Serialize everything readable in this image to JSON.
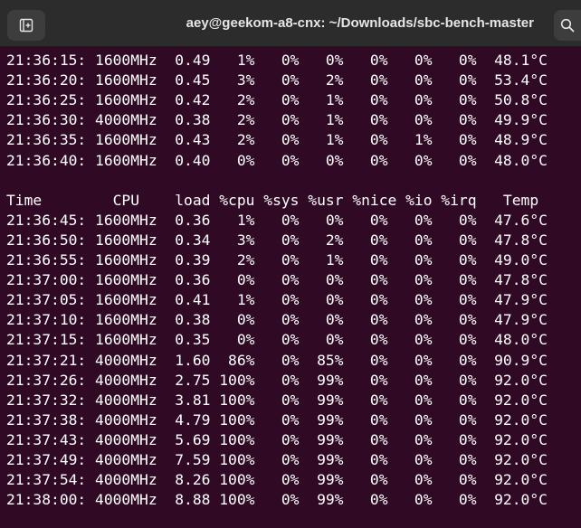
{
  "window": {
    "title": "aey@geekom-a8-cnx: ~/Downloads/sbc-bench-master"
  },
  "icons": {
    "new_tab": "new-tab-icon",
    "search": "search-icon"
  },
  "colors": {
    "terminal_bg": "#300a24",
    "titlebar_bg": "#2c2c2c",
    "text": "#ffffff"
  },
  "terminal": {
    "lines": [
      "21:36:15: 1600MHz  0.49   1%   0%   0%   0%   0%   0%  48.1°C",
      "21:36:20: 1600MHz  0.45   3%   0%   2%   0%   0%   0%  53.4°C",
      "21:36:25: 1600MHz  0.42   2%   0%   1%   0%   0%   0%  50.8°C",
      "21:36:30: 4000MHz  0.38   2%   0%   1%   0%   0%   0%  49.9°C",
      "21:36:35: 1600MHz  0.43   2%   0%   1%   0%   1%   0%  48.9°C",
      "21:36:40: 1600MHz  0.40   0%   0%   0%   0%   0%   0%  48.0°C",
      "",
      "Time        CPU    load %cpu %sys %usr %nice %io %irq   Temp",
      "21:36:45: 1600MHz  0.36   1%   0%   0%   0%   0%   0%  47.6°C",
      "21:36:50: 1600MHz  0.34   3%   0%   2%   0%   0%   0%  47.8°C",
      "21:36:55: 1600MHz  0.39   2%   0%   1%   0%   0%   0%  49.0°C",
      "21:37:00: 1600MHz  0.36   0%   0%   0%   0%   0%   0%  47.8°C",
      "21:37:05: 1600MHz  0.41   1%   0%   0%   0%   0%   0%  47.9°C",
      "21:37:10: 1600MHz  0.38   0%   0%   0%   0%   0%   0%  47.9°C",
      "21:37:15: 1600MHz  0.35   0%   0%   0%   0%   0%   0%  48.0°C",
      "21:37:21: 4000MHz  1.60  86%   0%  85%   0%   0%   0%  90.9°C",
      "21:37:26: 4000MHz  2.75 100%   0%  99%   0%   0%   0%  92.0°C",
      "21:37:32: 4000MHz  3.81 100%   0%  99%   0%   0%   0%  92.0°C",
      "21:37:38: 4000MHz  4.79 100%   0%  99%   0%   0%   0%  92.0°C",
      "21:37:43: 4000MHz  5.69 100%   0%  99%   0%   0%   0%  92.0°C",
      "21:37:49: 4000MHz  7.59 100%   0%  99%   0%   0%   0%  92.0°C",
      "21:37:54: 4000MHz  8.26 100%   0%  99%   0%   0%   0%  92.0°C",
      "21:38:00: 4000MHz  8.88 100%   0%  99%   0%   0%   0%  92.0°C"
    ]
  }
}
